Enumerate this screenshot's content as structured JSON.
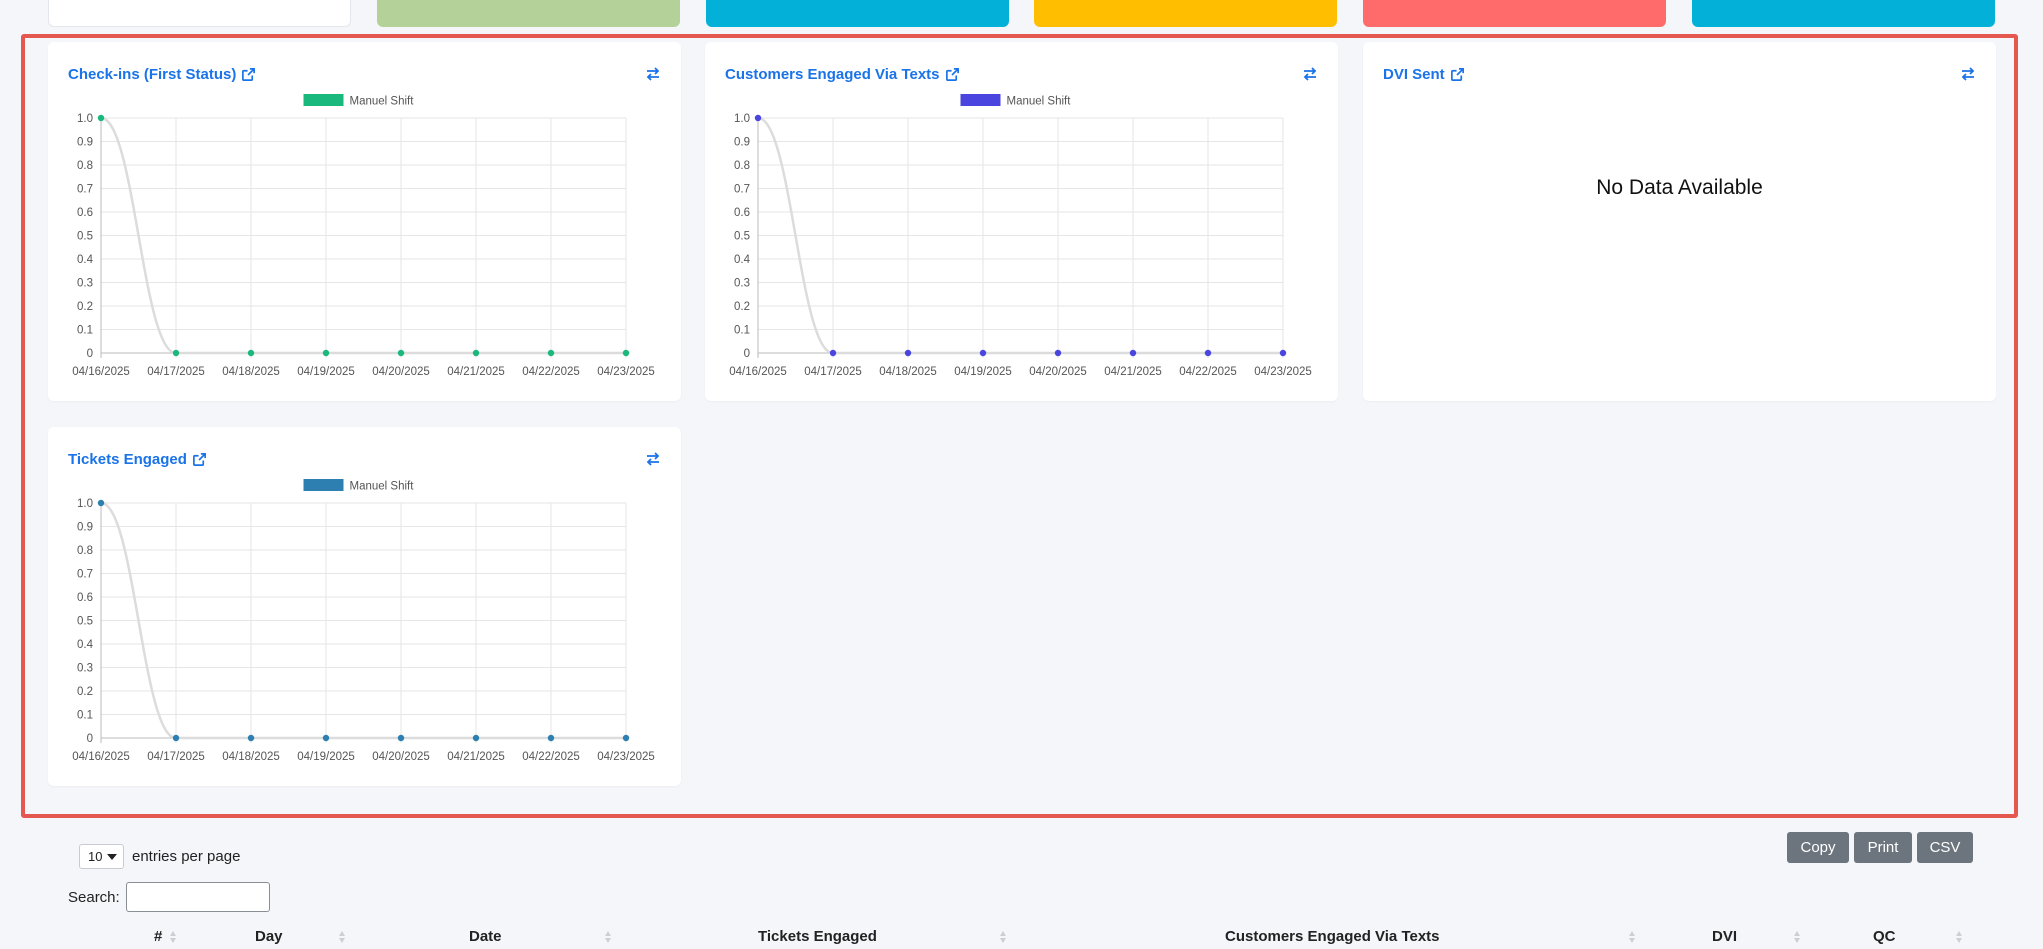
{
  "colors": {
    "accent": "#1a73e8",
    "highlight": "#e5584f",
    "tiles": [
      "#ffffff",
      "#b3d198",
      "#03b0d8",
      "#ffbf00",
      "#ff6b6b",
      "#03b0d8"
    ],
    "series": {
      "checkins": "#1ab87c",
      "texts": "#4a45df",
      "tickets": "#2c7fb0"
    }
  },
  "cards": {
    "checkins": {
      "title": "Check-ins (First Status)"
    },
    "texts": {
      "title": "Customers Engaged Via Texts"
    },
    "dvi": {
      "title": "DVI Sent",
      "empty_text": "No Data Available"
    },
    "tickets": {
      "title": "Tickets Engaged"
    }
  },
  "chart_data": [
    {
      "type": "line",
      "x": [
        "04/16/2025",
        "04/17/2025",
        "04/18/2025",
        "04/19/2025",
        "04/20/2025",
        "04/21/2025",
        "04/22/2025",
        "04/23/2025"
      ],
      "series": [
        {
          "name": "Manuel Shift",
          "values": [
            1,
            0,
            0,
            0,
            0,
            0,
            0,
            0
          ],
          "color": "#1ab87c"
        }
      ],
      "ylim": [
        0,
        1.0
      ],
      "yticks": [
        "0",
        "0.1",
        "0.2",
        "0.3",
        "0.4",
        "0.5",
        "0.6",
        "0.7",
        "0.8",
        "0.9",
        "1.0"
      ],
      "grid": true,
      "legend": "top-center"
    },
    {
      "type": "line",
      "x": [
        "04/16/2025",
        "04/17/2025",
        "04/18/2025",
        "04/19/2025",
        "04/20/2025",
        "04/21/2025",
        "04/22/2025",
        "04/23/2025"
      ],
      "series": [
        {
          "name": "Manuel Shift",
          "values": [
            1,
            0,
            0,
            0,
            0,
            0,
            0,
            0
          ],
          "color": "#4a45df"
        }
      ],
      "ylim": [
        0,
        1.0
      ],
      "yticks": [
        "0",
        "0.1",
        "0.2",
        "0.3",
        "0.4",
        "0.5",
        "0.6",
        "0.7",
        "0.8",
        "0.9",
        "1.0"
      ],
      "grid": true,
      "legend": "top-center"
    },
    {
      "type": "line",
      "x": [
        "04/16/2025",
        "04/17/2025",
        "04/18/2025",
        "04/19/2025",
        "04/20/2025",
        "04/21/2025",
        "04/22/2025",
        "04/23/2025"
      ],
      "series": [
        {
          "name": "Manuel Shift",
          "values": [
            1,
            0,
            0,
            0,
            0,
            0,
            0,
            0
          ],
          "color": "#2c7fb0"
        }
      ],
      "ylim": [
        0,
        1.0
      ],
      "yticks": [
        "0",
        "0.1",
        "0.2",
        "0.3",
        "0.4",
        "0.5",
        "0.6",
        "0.7",
        "0.8",
        "0.9",
        "1.0"
      ],
      "grid": true,
      "legend": "top-center"
    }
  ],
  "table": {
    "entries_value": "10",
    "entries_label": "entries per page",
    "search_label": "Search:",
    "buttons": {
      "copy": "Copy",
      "print": "Print",
      "csv": "CSV"
    },
    "columns": [
      "#",
      "Day",
      "Date",
      "Tickets Engaged",
      "Customers Engaged Via Texts",
      "DVI",
      "QC"
    ]
  }
}
